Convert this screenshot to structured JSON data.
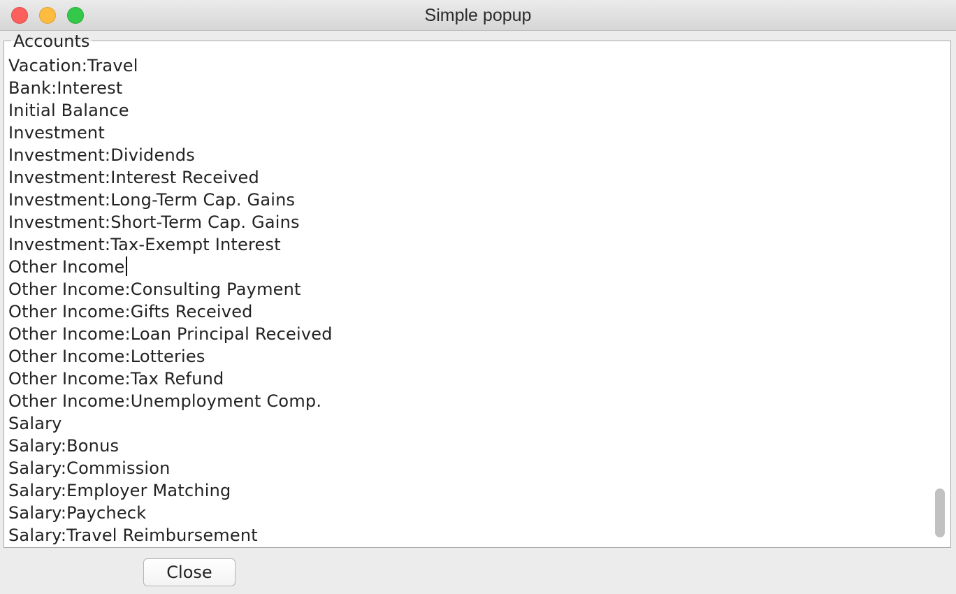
{
  "window": {
    "title": "Simple popup"
  },
  "group": {
    "legend": "Accounts"
  },
  "accounts": [
    "Vacation:Travel",
    "Bank:Interest",
    "Initial Balance",
    "Investment",
    "Investment:Dividends",
    "Investment:Interest Received",
    "Investment:Long-Term Cap. Gains",
    "Investment:Short-Term Cap. Gains",
    "Investment:Tax-Exempt Interest",
    "Other Income",
    "Other Income:Consulting Payment",
    "Other Income:Gifts Received",
    "Other Income:Loan Principal Received",
    "Other Income:Lotteries",
    "Other Income:Tax Refund",
    "Other Income:Unemployment Comp.",
    "Salary",
    "Salary:Bonus",
    "Salary:Commission",
    "Salary:Employer Matching",
    "Salary:Paycheck",
    "Salary:Travel Reimbursement"
  ],
  "buttons": {
    "close_label": "Close"
  },
  "colors": {
    "traffic_close": "#fc605c",
    "traffic_minimize": "#fdbc40",
    "traffic_maximize": "#34c84a"
  }
}
